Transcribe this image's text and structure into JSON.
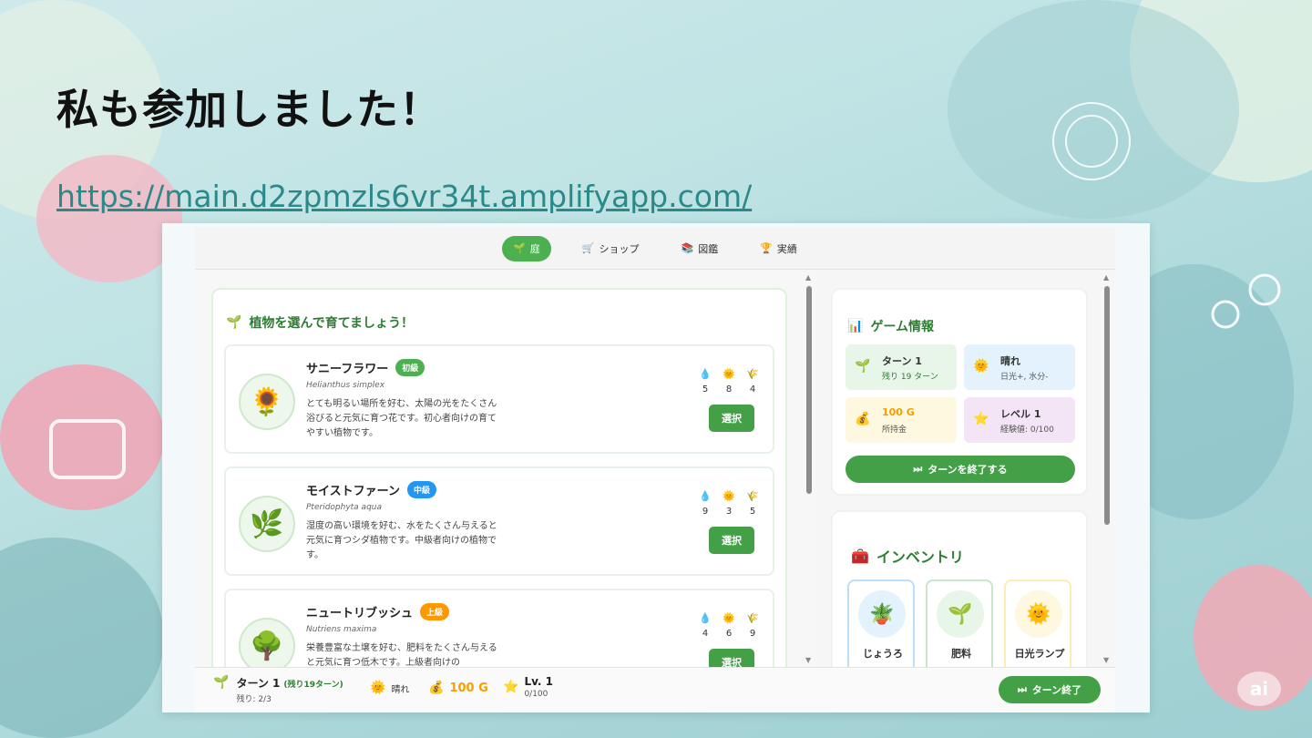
{
  "slide": {
    "title": "私も参加しました！",
    "link": "https://main.d2zpmzls6vr34t.amplifyapp.com/"
  },
  "app": {
    "tabs": [
      {
        "icon": "🌱",
        "label": "庭",
        "active": true
      },
      {
        "icon": "🛒",
        "label": "ショップ",
        "active": false
      },
      {
        "icon": "📚",
        "label": "図鑑",
        "active": false
      },
      {
        "icon": "🏆",
        "label": "実績",
        "active": false
      }
    ],
    "select_title": "植物を選んで育てましょう！",
    "plants": [
      {
        "name": "サニーフラワー",
        "badge": "初級",
        "badge_color": "#4caf50",
        "latin": "Helianthus simplex",
        "desc": "とても明るい場所を好む、太陽の光をたくさん浴びると元気に育つ花です。初心者向けの育てやすい植物です。",
        "water": "5",
        "sun": "8",
        "nutrient": "4",
        "button": "選択",
        "icon": "🌻"
      },
      {
        "name": "モイストファーン",
        "badge": "中級",
        "badge_color": "#2196f3",
        "latin": "Pteridophyta aqua",
        "desc": "湿度の高い環境を好む、水をたくさん与えると元気に育つシダ植物です。中級者向けの植物です。",
        "water": "9",
        "sun": "3",
        "nutrient": "5",
        "button": "選択",
        "icon": "🌿"
      },
      {
        "name": "ニュートリブッシュ",
        "badge": "上級",
        "badge_color": "#ff9800",
        "latin": "Nutriens maxima",
        "desc": "栄養豊富な土壌を好む、肥料をたくさん与えると元気に育つ低木です。上級者向けの",
        "water": "4",
        "sun": "6",
        "nutrient": "9",
        "button": "選択",
        "icon": "🌳"
      }
    ],
    "game_info": {
      "title": "ゲーム情報",
      "turn_label": "ターン 1",
      "turn_sub": "残り 19 ターン",
      "weather_label": "晴れ",
      "weather_sub": "日光+, 水分-",
      "gold_label": "100 G",
      "gold_sub": "所持金",
      "level_label": "レベル 1",
      "level_sub": "経験値: 0/100",
      "end_turn": "ターンを終了する"
    },
    "inventory": {
      "title": "インベントリ",
      "items": [
        {
          "label": "じょうろ",
          "icon": "🪴"
        },
        {
          "label": "肥料",
          "icon": "🌱"
        },
        {
          "label": "日光ランプ",
          "icon": "🌞"
        }
      ]
    },
    "bottom": {
      "turn": "ターン 1",
      "turn_remaining": "(残り19ターン)",
      "remaining": "残り: 2/3",
      "weather": "晴れ",
      "gold": "100 G",
      "level": "Lv. 1",
      "exp": "0/100",
      "end_button": "ターン終了"
    }
  },
  "ai_badge": "ai"
}
